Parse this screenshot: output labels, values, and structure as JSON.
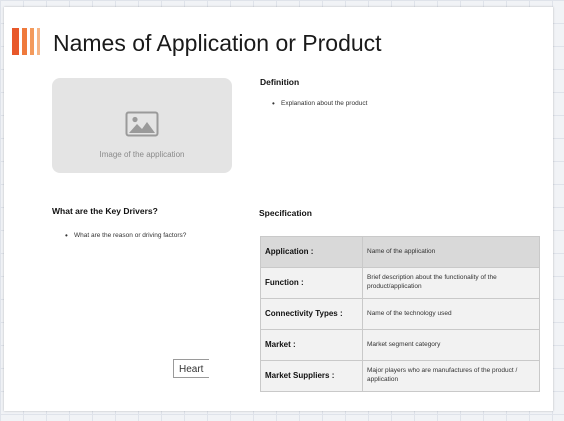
{
  "slide": {
    "title": "Names of Application or Product",
    "image_placeholder": {
      "caption": "Image of the application",
      "icon": "image-icon"
    },
    "definition": {
      "heading": "Definition",
      "bullets": [
        "Explanation about the product"
      ]
    },
    "key_drivers": {
      "heading": "What are the Key Drivers?",
      "bullets": [
        "What are the reason or driving factors?"
      ]
    },
    "specification": {
      "heading": "Specification",
      "rows": [
        {
          "label": "Application :",
          "value": "Name of the application"
        },
        {
          "label": "Function :",
          "value": "Brief description about the functionality of the product/application"
        },
        {
          "label": "Connectivity Types :",
          "value": "Name of the technology used"
        },
        {
          "label": "Market :",
          "value": "Market segment category"
        },
        {
          "label": "Market Suppliers :",
          "value": "Major players who are manufactures of the product / application"
        }
      ]
    },
    "floating_box": {
      "text": "Heart"
    }
  },
  "colors": {
    "accent_bars": [
      "#e8582a",
      "#ef7a3c",
      "#f39a5c",
      "#f6b586"
    ],
    "table_header_row": "#d9d9d9",
    "table_row": "#f2f2f2",
    "placeholder_bg": "#e4e4e4"
  }
}
